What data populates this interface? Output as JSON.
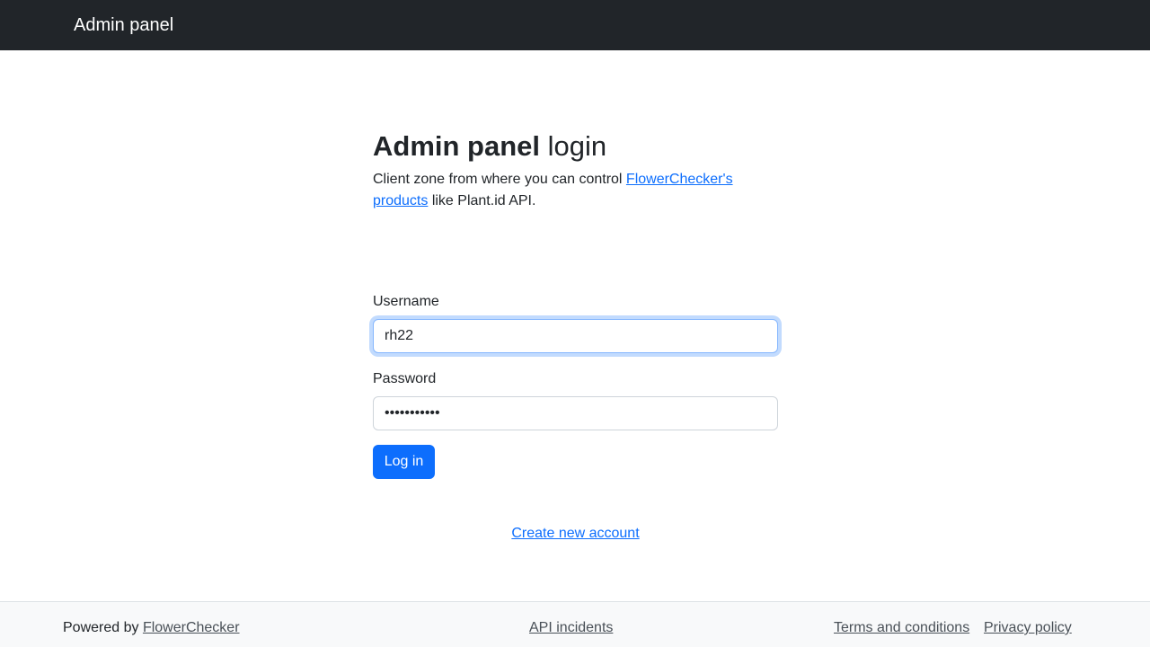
{
  "navbar": {
    "brand": "Admin panel"
  },
  "main": {
    "title_bold": "Admin panel",
    "title_rest": " login",
    "lead_prefix": "Client zone from where you can control ",
    "lead_link": "FlowerChecker's products",
    "lead_suffix": " like Plant.id API.",
    "username_label": "Username",
    "username_value": "rh22",
    "password_label": "Password",
    "password_value": "•••••••••••",
    "login_button": "Log in",
    "create_account_link": "Create new account"
  },
  "footer": {
    "powered_prefix": "Powered by ",
    "powered_link": "FlowerChecker",
    "api_incidents": "API incidents",
    "terms": "Terms and conditions",
    "privacy": "Privacy policy"
  },
  "colors": {
    "navbar_bg": "#212529",
    "primary": "#0d6efd",
    "footer_bg": "#f8f9fa"
  }
}
